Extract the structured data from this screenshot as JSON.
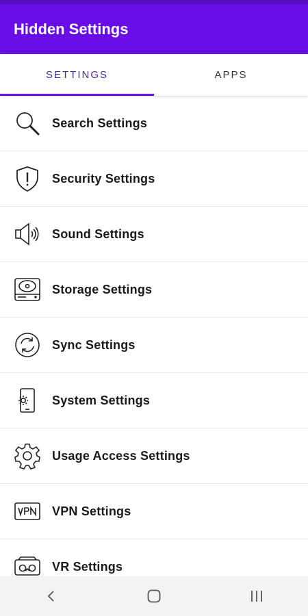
{
  "app": {
    "title": "Hidden Settings"
  },
  "tabs": [
    {
      "label": "SETTINGS",
      "active": true
    },
    {
      "label": "APPS",
      "active": false
    }
  ],
  "settings": [
    {
      "label": "Search Settings",
      "icon": "search-icon"
    },
    {
      "label": "Security Settings",
      "icon": "shield-alert-icon"
    },
    {
      "label": "Sound Settings",
      "icon": "speaker-icon"
    },
    {
      "label": "Storage Settings",
      "icon": "hard-drive-icon"
    },
    {
      "label": "Sync Settings",
      "icon": "sync-icon"
    },
    {
      "label": "System Settings",
      "icon": "phone-gear-icon"
    },
    {
      "label": "Usage Access Settings",
      "icon": "gear-icon"
    },
    {
      "label": "VPN Settings",
      "icon": "vpn-icon"
    },
    {
      "label": "VR Settings",
      "icon": "vr-headset-icon"
    }
  ],
  "nav": [
    {
      "icon": "back-icon"
    },
    {
      "icon": "home-icon"
    },
    {
      "icon": "recents-icon"
    }
  ],
  "colors": {
    "app_bar": "#6a0ee8",
    "status_bar": "#5a0ec4",
    "active_tab_text": "#4a2aa0",
    "nav_bar": "#f3f3f3"
  }
}
